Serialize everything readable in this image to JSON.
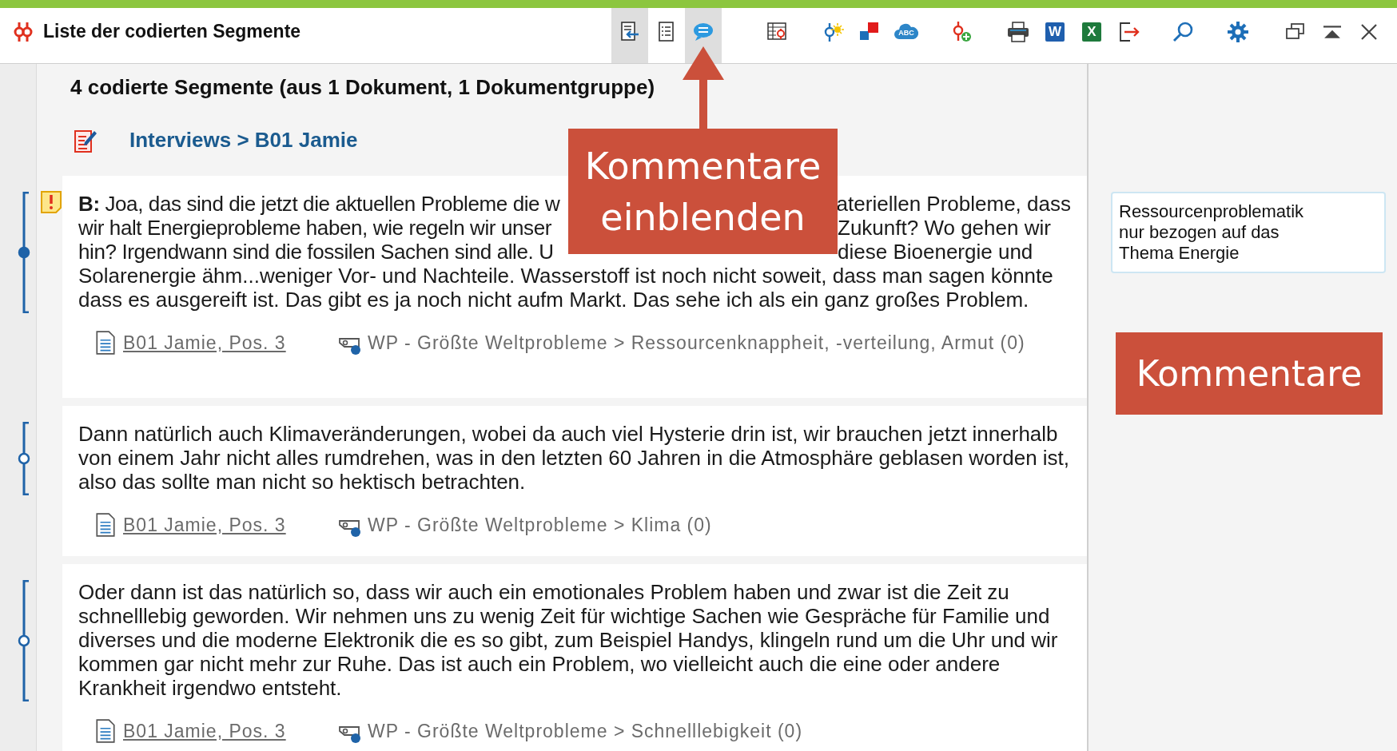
{
  "window": {
    "title": "Liste der codierten Segmente"
  },
  "toolbar": [
    {
      "kind": "import",
      "on": true
    },
    {
      "kind": "list",
      "on": false
    },
    {
      "kind": "comments",
      "on": true
    },
    {
      "kind": "table"
    },
    {
      "kind": "sun"
    },
    {
      "kind": "squares"
    },
    {
      "kind": "cloud",
      "glyph": "ABC"
    },
    {
      "kind": "addcode"
    },
    {
      "kind": "print"
    },
    {
      "kind": "word",
      "glyph": "W"
    },
    {
      "kind": "excel",
      "glyph": "X"
    },
    {
      "kind": "export"
    },
    {
      "kind": "search"
    },
    {
      "kind": "settings"
    },
    {
      "kind": "restore"
    },
    {
      "kind": "collapse"
    },
    {
      "kind": "close"
    }
  ],
  "heading": "4 codierte Segmente (aus 1 Dokument, 1 Dokumentgruppe)",
  "document_path": "Interviews > B01 Jamie",
  "segments": [
    {
      "commented": true,
      "memo": true,
      "lines": [
        {
          "left": "**B:** Joa, das sind die jetzt die aktuellen Probleme die w",
          "right": "ateriellen Probleme, dass"
        },
        {
          "left": "wir halt Energieprobleme haben, wie regeln wir unser",
          "right": "Zukunft? Wo gehen wir"
        },
        {
          "left": "hin? Irgendwann sind die fossilen Sachen sind alle. U",
          "right": "diese Bioenergie und"
        },
        {
          "text": "Solarenergie ähm...weniger Vor- und Nachteile. Wasserstoff ist noch nicht soweit, dass man sagen könnte"
        },
        {
          "text": "dass es ausgereift ist. Das gibt es ja noch nicht aufm Markt. Das sehe ich als ein ganz großes Problem."
        }
      ],
      "source": "B01 Jamie, Pos. 3",
      "code": "WP - Größte Weltprobleme > Ressourcenknappheit, -verteilung, Armut (0)"
    },
    {
      "commented": false,
      "memo": false,
      "text": "Dann natürlich auch Klimaveränderungen, wobei da auch viel Hysterie drin ist, wir brauchen jetzt innerhalb von einem Jahr nicht alles rumdrehen, was in den letzten 60 Jahren in die Atmosphäre geblasen worden ist, also das sollte man nicht so hektisch betrachten.",
      "source": "B01 Jamie, Pos. 3",
      "code": "WP - Größte Weltprobleme > Klima (0)"
    },
    {
      "commented": false,
      "memo": false,
      "text": "Oder dann ist das natürlich so, dass wir auch ein emotionales Problem haben und zwar ist die Zeit zu schnelllebig geworden. Wir nehmen uns zu wenig Zeit für wichtige Sachen wie Gespräche für Familie und diverses und die moderne Elektronik die es so gibt, zum Beispiel Handys, klingeln rund um die Uhr und wir kommen gar nicht mehr zur Ruhe. Das ist auch ein Problem, wo vielleicht auch die eine oder andere Krankheit irgendwo entsteht.",
      "source": "B01 Jamie, Pos. 3",
      "code": "WP - Größte Weltprobleme > Schnelllebigkeit (0)"
    }
  ],
  "comments": [
    {
      "text": "Ressourcenproblematik nur bezogen auf das Thema Energie"
    }
  ],
  "callouts": [
    {
      "text": "Kommentare einblenden"
    },
    {
      "text": "Kommentare"
    }
  ]
}
